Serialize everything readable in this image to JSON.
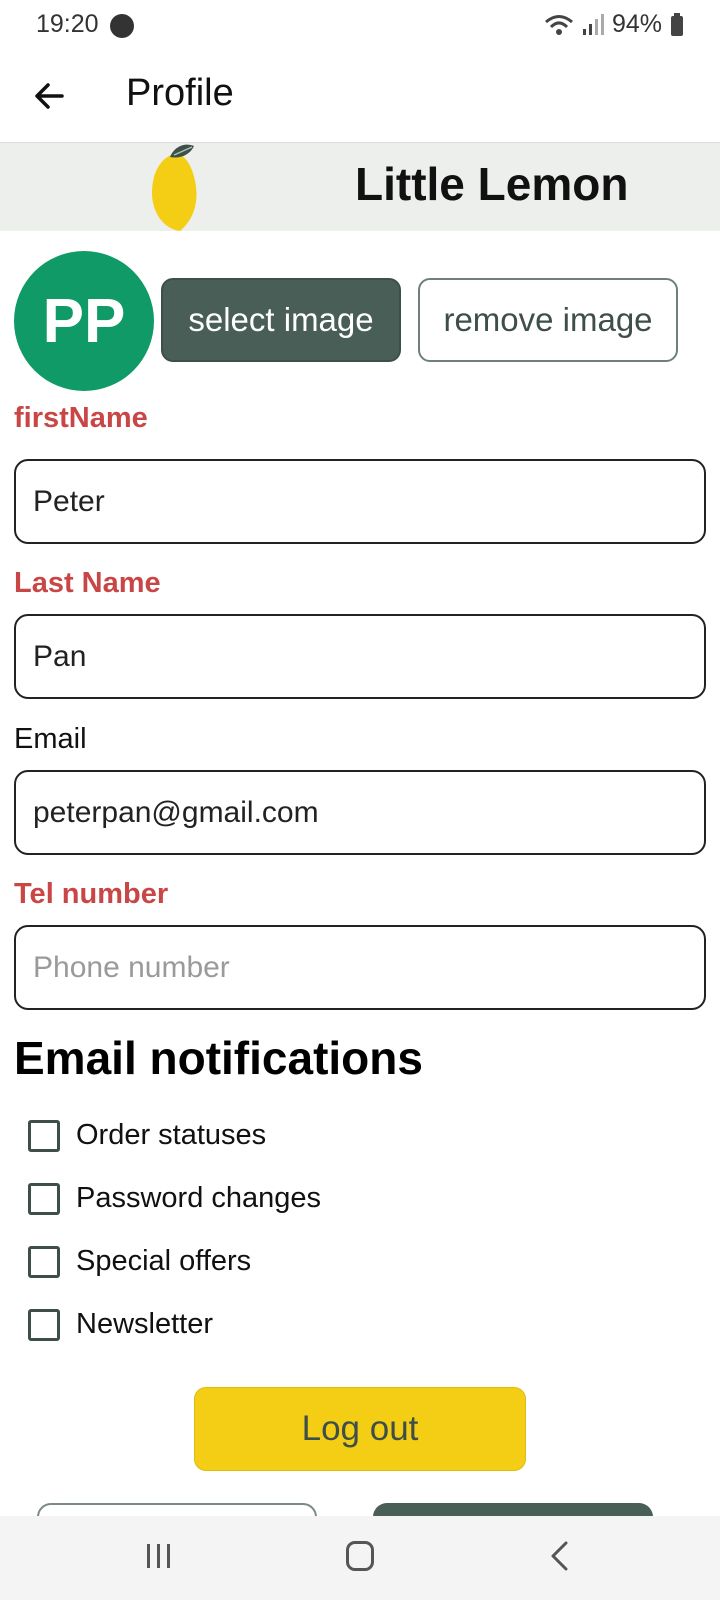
{
  "status_bar": {
    "time": "19:20",
    "battery": "94%"
  },
  "app_bar": {
    "title": "Profile"
  },
  "banner": {
    "brand": "Little Lemon"
  },
  "profile": {
    "avatar_initials": "PP",
    "select_image_label": "select image",
    "remove_image_label": "remove image"
  },
  "form": {
    "first_name": {
      "label": "firstName",
      "value": "Peter"
    },
    "last_name": {
      "label": "Last Name",
      "value": "Pan"
    },
    "email": {
      "label": "Email",
      "value": "peterpan@gmail.com"
    },
    "phone": {
      "label": "Tel number",
      "value": "",
      "placeholder": "Phone number"
    }
  },
  "notifications": {
    "title": "Email notifications",
    "options": [
      {
        "label": "Order statuses",
        "checked": false
      },
      {
        "label": "Password changes",
        "checked": false
      },
      {
        "label": "Special offers",
        "checked": false
      },
      {
        "label": "Newsletter",
        "checked": false
      }
    ]
  },
  "actions": {
    "logout_label": "Log out"
  },
  "colors": {
    "primary_green": "#495e57",
    "accent_yellow": "#f4ce14",
    "error_red": "#c94646",
    "avatar_green": "#0f9a67",
    "banner_bg": "#edefed"
  }
}
